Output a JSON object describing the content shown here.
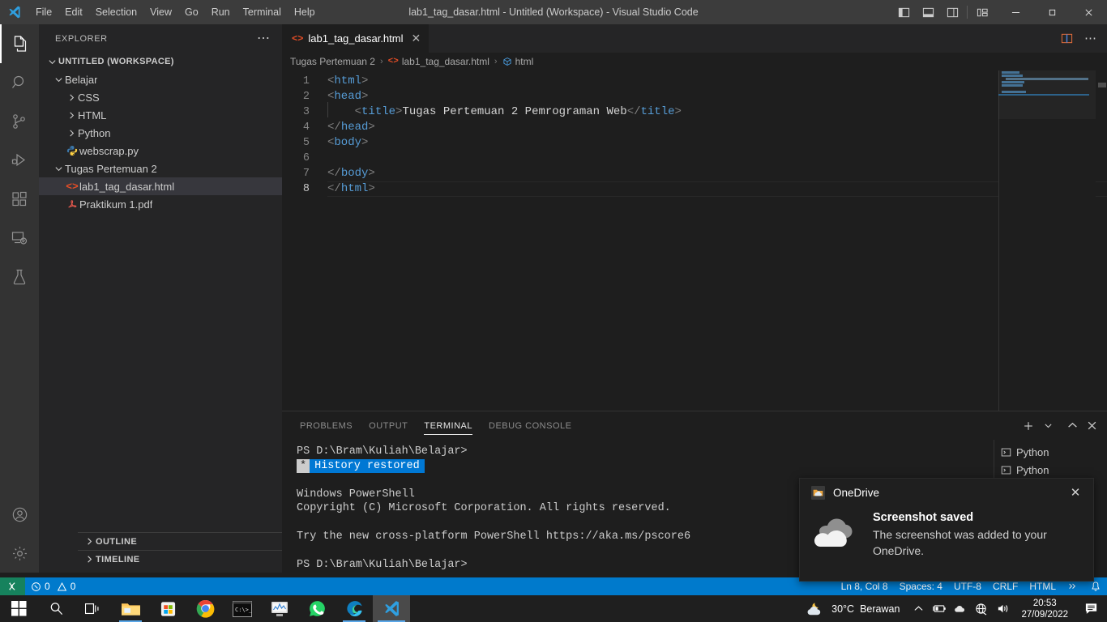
{
  "titlebar": {
    "window_title": "lab1_tag_dasar.html - Untitled (Workspace) - Visual Studio Code",
    "menus": [
      "File",
      "Edit",
      "Selection",
      "View",
      "Go",
      "Run",
      "Terminal",
      "Help"
    ],
    "layout_buttons": [
      "toggle-primary-sidebar",
      "toggle-panel",
      "toggle-secondary-sidebar",
      "customize-layout"
    ],
    "window_buttons": {
      "minimize": "─",
      "maximize": "❐",
      "close": "✕"
    }
  },
  "activitybar": {
    "items": [
      {
        "name": "explorer",
        "icon": "files-icon",
        "active": true
      },
      {
        "name": "search",
        "icon": "search-icon",
        "active": false
      },
      {
        "name": "source-control",
        "icon": "source-control-icon",
        "active": false
      },
      {
        "name": "run-and-debug",
        "icon": "debug-icon",
        "active": false
      },
      {
        "name": "extensions",
        "icon": "extensions-icon",
        "active": false
      },
      {
        "name": "remote-explorer",
        "icon": "remote-explorer-icon",
        "active": false
      },
      {
        "name": "testing",
        "icon": "flask-icon",
        "active": false
      }
    ],
    "bottom_items": [
      {
        "name": "accounts",
        "icon": "account-icon"
      },
      {
        "name": "manage",
        "icon": "gear-icon"
      }
    ]
  },
  "sidebar": {
    "title": "EXPLORER",
    "more_actions": "⋯",
    "tree": [
      {
        "label": "UNTITLED (WORKSPACE)",
        "depth": 0,
        "type": "root",
        "expanded": true,
        "selected": false
      },
      {
        "label": "Belajar",
        "depth": 1,
        "type": "folder",
        "expanded": true,
        "selected": false
      },
      {
        "label": "CSS",
        "depth": 2,
        "type": "folder",
        "expanded": false,
        "selected": false
      },
      {
        "label": "HTML",
        "depth": 2,
        "type": "folder",
        "expanded": false,
        "selected": false
      },
      {
        "label": "Python",
        "depth": 2,
        "type": "folder",
        "expanded": false,
        "selected": false
      },
      {
        "label": "webscrap.py",
        "depth": 2,
        "type": "python",
        "expanded": null,
        "selected": false
      },
      {
        "label": "Tugas Pertemuan 2",
        "depth": 1,
        "type": "folder",
        "expanded": true,
        "selected": false
      },
      {
        "label": "lab1_tag_dasar.html",
        "depth": 2,
        "type": "html",
        "expanded": null,
        "selected": true
      },
      {
        "label": "Praktikum 1.pdf",
        "depth": 2,
        "type": "pdf",
        "expanded": null,
        "selected": false
      }
    ],
    "sections": [
      {
        "label": "OUTLINE",
        "expanded": false
      },
      {
        "label": "TIMELINE",
        "expanded": false
      }
    ]
  },
  "editor": {
    "tabs": [
      {
        "label": "lab1_tag_dasar.html",
        "icon": "html-icon",
        "active": true,
        "close": "✕"
      }
    ],
    "tab_actions": [
      "split-editor",
      "more-actions"
    ],
    "breadcrumb": [
      {
        "label": "Tugas Pertemuan 2",
        "icon": null
      },
      {
        "label": "lab1_tag_dasar.html",
        "icon": "html-icon"
      },
      {
        "label": "html",
        "icon": "symbol-icon"
      }
    ],
    "breadcrumb_separator": "›",
    "lines": [
      {
        "n": "1",
        "indent": 0,
        "tokens": [
          {
            "t": "<",
            "c": "bracket"
          },
          {
            "t": "html",
            "c": "tag"
          },
          {
            "t": ">",
            "c": "bracket"
          }
        ]
      },
      {
        "n": "2",
        "indent": 0,
        "tokens": [
          {
            "t": "<",
            "c": "bracket"
          },
          {
            "t": "head",
            "c": "tag"
          },
          {
            "t": ">",
            "c": "bracket"
          }
        ]
      },
      {
        "n": "3",
        "indent": 1,
        "tokens": [
          {
            "t": "    <",
            "c": "bracket"
          },
          {
            "t": "title",
            "c": "tag"
          },
          {
            "t": ">",
            "c": "bracket"
          },
          {
            "t": "Tugas Pertemuan 2 Pemrograman Web",
            "c": "text"
          },
          {
            "t": "</",
            "c": "bracket"
          },
          {
            "t": "title",
            "c": "tag"
          },
          {
            "t": ">",
            "c": "bracket"
          }
        ]
      },
      {
        "n": "4",
        "indent": 0,
        "tokens": [
          {
            "t": "</",
            "c": "bracket"
          },
          {
            "t": "head",
            "c": "tag"
          },
          {
            "t": ">",
            "c": "bracket"
          }
        ]
      },
      {
        "n": "5",
        "indent": 0,
        "tokens": [
          {
            "t": "<",
            "c": "bracket"
          },
          {
            "t": "body",
            "c": "tag"
          },
          {
            "t": ">",
            "c": "bracket"
          }
        ]
      },
      {
        "n": "6",
        "indent": 0,
        "tokens": []
      },
      {
        "n": "7",
        "indent": 0,
        "tokens": [
          {
            "t": "</",
            "c": "bracket"
          },
          {
            "t": "body",
            "c": "tag"
          },
          {
            "t": ">",
            "c": "bracket"
          }
        ]
      },
      {
        "n": "8",
        "indent": 0,
        "current": true,
        "tokens": [
          {
            "t": "</",
            "c": "bracket"
          },
          {
            "t": "html",
            "c": "tag"
          },
          {
            "t": ">",
            "c": "bracket"
          }
        ]
      }
    ]
  },
  "panel": {
    "tabs": [
      {
        "label": "PROBLEMS",
        "active": false
      },
      {
        "label": "OUTPUT",
        "active": false
      },
      {
        "label": "TERMINAL",
        "active": true
      },
      {
        "label": "DEBUG CONSOLE",
        "active": false
      }
    ],
    "actions": [
      "new-terminal",
      "terminal-dropdown",
      "maximize-panel",
      "close-panel"
    ],
    "terminal_lines": [
      {
        "text": "PS D:\\Bram\\Kuliah\\Belajar>",
        "style": "plain"
      },
      {
        "text": "History restored",
        "style": "history",
        "chip": "*"
      },
      {
        "text": "",
        "style": "plain"
      },
      {
        "text": "Windows PowerShell",
        "style": "plain"
      },
      {
        "text": "Copyright (C) Microsoft Corporation. All rights reserved.",
        "style": "plain"
      },
      {
        "text": "",
        "style": "plain"
      },
      {
        "text": "Try the new cross-platform PowerShell https://aka.ms/pscore6",
        "style": "plain"
      },
      {
        "text": "",
        "style": "plain"
      },
      {
        "text": "PS D:\\Bram\\Kuliah\\Belajar>",
        "style": "plain"
      }
    ],
    "terminal_tabs": [
      {
        "label": "Python",
        "icon": "terminal-icon"
      },
      {
        "label": "Python",
        "icon": "terminal-icon"
      }
    ]
  },
  "statusbar": {
    "remote_icon": "remote-window-icon",
    "left_items": [
      {
        "name": "problems",
        "icon": "error-warning",
        "errors": "0",
        "warnings": "0"
      }
    ],
    "right_items": [
      {
        "name": "editor-position",
        "label": "Ln 8, Col 8"
      },
      {
        "name": "editor-indentation",
        "label": "Spaces: 4"
      },
      {
        "name": "editor-encoding",
        "label": "UTF-8"
      },
      {
        "name": "editor-eol",
        "label": "CRLF"
      },
      {
        "name": "editor-language",
        "label": "HTML"
      },
      {
        "name": "prettier",
        "label": "✓"
      },
      {
        "name": "notifications",
        "label": "🔔"
      }
    ]
  },
  "notification": {
    "app": "OneDrive",
    "title": "Screenshot saved",
    "message": "The screenshot was added to your OneDrive.",
    "close": "✕"
  },
  "taskbar": {
    "items": [
      {
        "name": "start",
        "icon": "windows-icon",
        "state": "idle"
      },
      {
        "name": "search",
        "icon": "search-icon",
        "state": "idle"
      },
      {
        "name": "task-view",
        "icon": "task-view-icon",
        "state": "idle"
      },
      {
        "name": "file-explorer",
        "icon": "folder-icon",
        "state": "running"
      },
      {
        "name": "microsoft-store",
        "icon": "store-icon",
        "state": "idle"
      },
      {
        "name": "google-chrome",
        "icon": "chrome-icon",
        "state": "idle"
      },
      {
        "name": "command-prompt",
        "icon": "terminal-icon",
        "state": "idle"
      },
      {
        "name": "task-manager",
        "icon": "task-manager-icon",
        "state": "idle"
      },
      {
        "name": "whatsapp",
        "icon": "whatsapp-icon",
        "state": "idle"
      },
      {
        "name": "microsoft-edge",
        "icon": "edge-icon",
        "state": "running"
      },
      {
        "name": "visual-studio-code",
        "icon": "vscode-icon",
        "state": "active"
      }
    ],
    "weather": {
      "temperature": "30°C",
      "condition": "Berawan",
      "icon": "cloudy-night-icon"
    },
    "tray": [
      "show-hidden-icons",
      "battery-icon",
      "onedrive-icon",
      "network-icon",
      "volume-icon"
    ],
    "clock": {
      "time": "20:53",
      "date": "27/09/2022"
    },
    "notification_center": "notifications-icon"
  }
}
